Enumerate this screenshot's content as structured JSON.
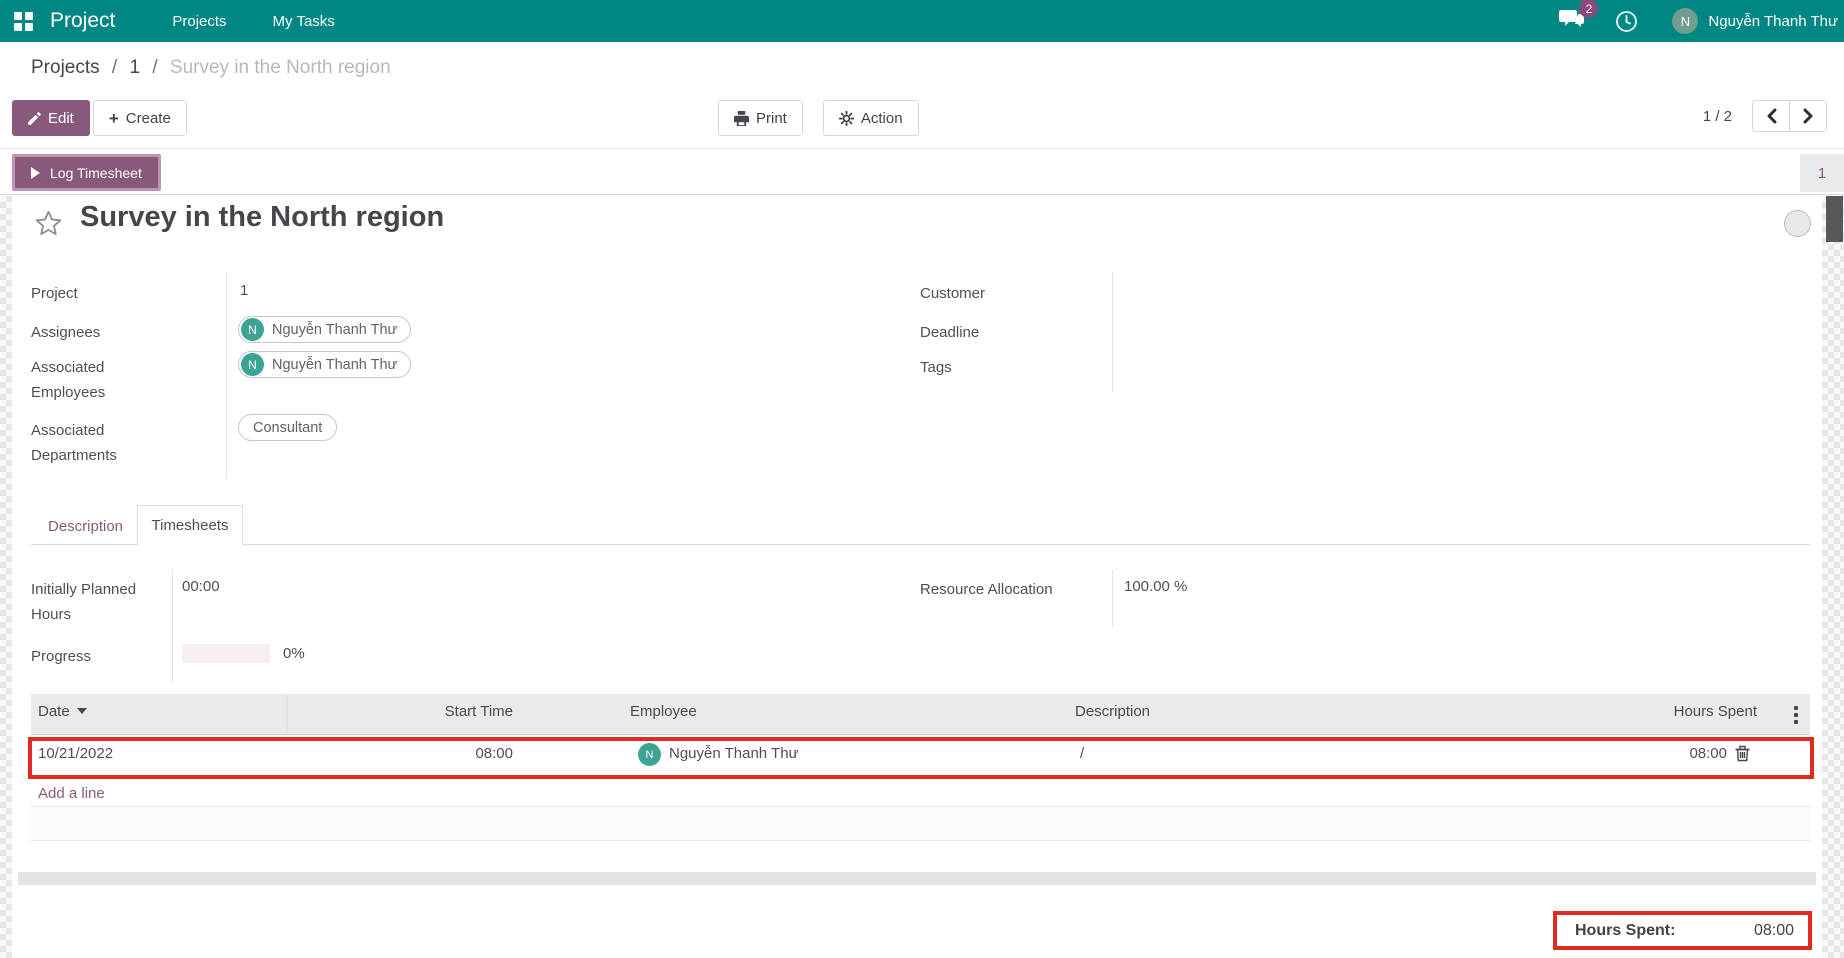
{
  "colors": {
    "navbar_teal": "#008784",
    "primary_purple": "#875a7b",
    "annotation_red": "#df2a1f",
    "avatar_teal": "#3da394"
  },
  "navbar": {
    "app_name": "Project",
    "menu": [
      {
        "label": "Projects"
      },
      {
        "label": "My Tasks"
      }
    ],
    "message_badge": "2",
    "user_initial": "N",
    "user_name": "Nguyễn Thanh Thư"
  },
  "breadcrumb": {
    "root": "Projects",
    "separator": "/",
    "record_id": "1",
    "current": "Survey in the North region"
  },
  "control_panel": {
    "edit": "Edit",
    "create": "Create",
    "print": "Print",
    "action": "Action",
    "pager": "1 / 2"
  },
  "statusbar": {
    "log_timesheet": "Log Timesheet",
    "stage_badge": "1"
  },
  "task": {
    "title": "Survey in the North region",
    "project_label": "Project",
    "project_value": "1",
    "assignees_label": "Assignees",
    "assignee_initial": "N",
    "assignee_name": "Nguyễn Thanh Thư",
    "employees_label": "Associated Employees",
    "employee_initial": "N",
    "employee_name": "Nguyễn Thanh Thư",
    "departments_label": "Associated Departments",
    "department_name": "Consultant",
    "customer_label": "Customer",
    "deadline_label": "Deadline",
    "tags_label": "Tags"
  },
  "tabs": {
    "description": "Description",
    "timesheets": "Timesheets"
  },
  "details": {
    "planned_label": "Initially Planned Hours",
    "planned_value": "00:00",
    "progress_label": "Progress",
    "progress_value": "0%",
    "progress_pct": 0,
    "resource_label": "Resource Allocation",
    "resource_value": "100.00 %"
  },
  "timesheets": {
    "columns": [
      "Date",
      "Start Time",
      "Employee",
      "Description",
      "Hours Spent"
    ],
    "rows": [
      {
        "date": "10/21/2022",
        "start_time": "08:00",
        "employee_initial": "N",
        "employee": "Nguyễn Thanh Thư",
        "description": "/",
        "hours_spent": "08:00"
      }
    ],
    "add_line": "Add a line",
    "total_label": "Hours Spent:",
    "total_value": "08:00"
  }
}
